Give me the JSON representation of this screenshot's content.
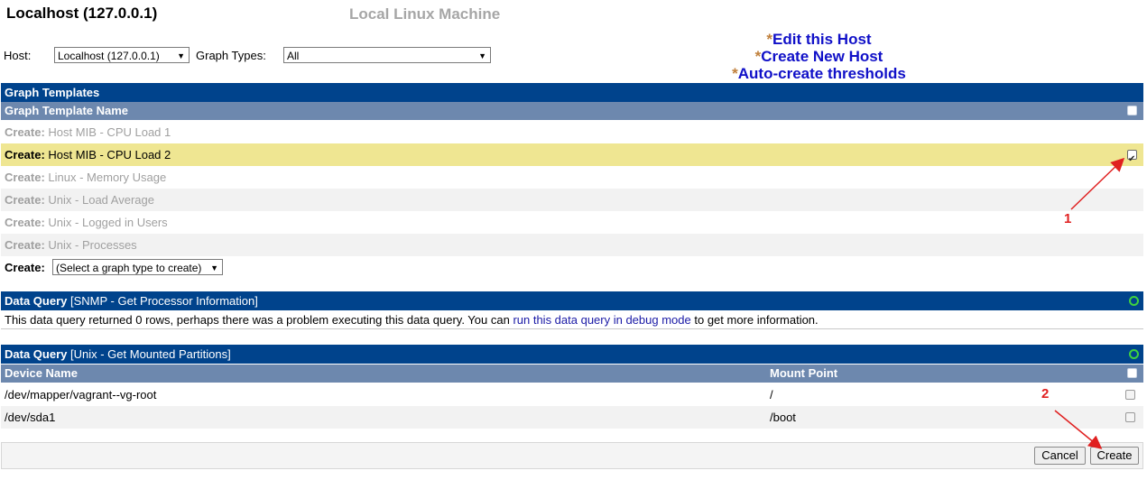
{
  "header": {
    "title": "Localhost (127.0.0.1)",
    "subtitle": "Local Linux Machine"
  },
  "filters": {
    "host_label": "Host:",
    "host_value": "Localhost (127.0.0.1)",
    "graph_types_label": "Graph Types:",
    "graph_types_value": "All"
  },
  "actions": {
    "star": "*",
    "edit_host": "Edit this Host",
    "create_host": "Create New Host",
    "auto_thresholds": "Auto-create thresholds"
  },
  "graph_templates": {
    "section_title": "Graph Templates",
    "column_name": "Graph Template Name",
    "create_prefix": "Create:",
    "rows": [
      {
        "name": "Host MIB - CPU Load 1",
        "checked": false,
        "enabled": false
      },
      {
        "name": "Host MIB - CPU Load 2",
        "checked": true,
        "enabled": true
      },
      {
        "name": "Linux - Memory Usage",
        "checked": false,
        "enabled": false
      },
      {
        "name": "Unix - Load Average",
        "checked": false,
        "enabled": false
      },
      {
        "name": "Unix - Logged in Users",
        "checked": false,
        "enabled": false
      },
      {
        "name": "Unix - Processes",
        "checked": false,
        "enabled": false
      }
    ],
    "create_select_label": "Create:",
    "create_select_value": "(Select a graph type to create)"
  },
  "data_query_1": {
    "label": "Data Query",
    "name": "[SNMP - Get Processor Information]",
    "message_before": "This data query returned 0 rows, perhaps there was a problem executing this data query. You can ",
    "message_link": "run this data query in debug mode",
    "message_after": " to get more information."
  },
  "data_query_2": {
    "label": "Data Query",
    "name": "[Unix - Get Mounted Partitions]",
    "col_device": "Device Name",
    "col_mount": "Mount Point",
    "rows": [
      {
        "device": "/dev/mapper/vagrant--vg-root",
        "mount": "/"
      },
      {
        "device": "/dev/sda1",
        "mount": "/boot"
      }
    ]
  },
  "buttons": {
    "cancel": "Cancel",
    "create": "Create"
  },
  "annotations": {
    "one": "1",
    "two": "2"
  }
}
